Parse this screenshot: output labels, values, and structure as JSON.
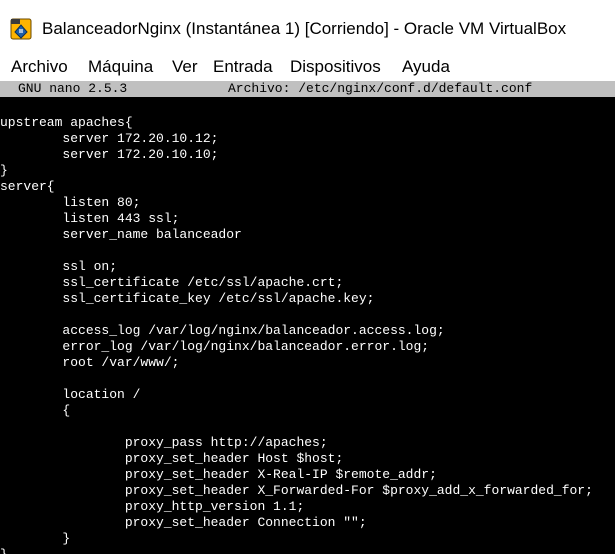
{
  "window": {
    "title": "BalanceadorNginx (Instantánea 1) [Corriendo] - Oracle VM VirtualBox",
    "icon": "virtualbox-app-icon"
  },
  "menu": {
    "items": [
      "Archivo",
      "Máquina",
      "Ver",
      "Entrada",
      "Dispositivos",
      "Ayuda"
    ]
  },
  "nano": {
    "version": "GNU nano 2.5.3",
    "file": "Archivo: /etc/nginx/conf.d/default.conf"
  },
  "code_lines": [
    "upstream apaches{",
    "        server 172.20.10.12;",
    "        server 172.20.10.10;",
    "}",
    "server{",
    "        listen 80;",
    "        listen 443 ssl;",
    "        server_name balanceador",
    "",
    "        ssl on;",
    "        ssl_certificate /etc/ssl/apache.crt;",
    "        ssl_certificate_key /etc/ssl/apache.key;",
    "",
    "        access_log /var/log/nginx/balanceador.access.log;",
    "        error_log /var/log/nginx/balanceador.error.log;",
    "        root /var/www/;",
    "",
    "        location /",
    "        {",
    "",
    "                proxy_pass http://apaches;",
    "                proxy_set_header Host $host;",
    "                proxy_set_header X-Real-IP $remote_addr;",
    "                proxy_set_header X_Forwarded-For $proxy_add_x_forwarded_for;",
    "                proxy_http_version 1.1;",
    "                proxy_set_header Connection \"\";",
    "        }",
    "}"
  ],
  "colors": {
    "terminal_bg": "#000000",
    "terminal_fg": "#ffffff",
    "nano_header_bg": "#c0c0c0"
  }
}
